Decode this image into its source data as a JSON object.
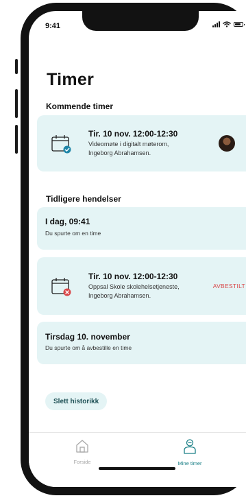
{
  "status_bar": {
    "time": "9:41"
  },
  "page": {
    "title": "Timer"
  },
  "upcoming": {
    "heading": "Kommende timer",
    "appointment": {
      "title": "Tir. 10 nov. 12:00-12:30",
      "line1": "Videomøte i digitalt møterom,",
      "line2": "Ingeborg Abrahamsen.",
      "icon": "calendar-check-icon"
    }
  },
  "history": {
    "heading": "Tidligere hendelser",
    "event1": {
      "title": "I dag, 09:41",
      "subtitle": "Du spurte om en time"
    },
    "cancelled": {
      "title": "Tir. 10 nov. 12:00-12:30",
      "line1": "Oppsal Skole skolehelsetjeneste,",
      "line2": "Ingeborg Abrahamsen.",
      "status": "AVBESTILT",
      "icon": "calendar-cancel-icon"
    },
    "event2": {
      "title": "Tirsdag 10. november",
      "subtitle": "Du spurte om å avbestille en time"
    }
  },
  "actions": {
    "clear_history": "Slett historikk"
  },
  "tabbar": {
    "tabs": [
      {
        "label": "Forside",
        "icon": "home-icon",
        "active": false
      },
      {
        "label": "Mine timer",
        "icon": "person-icon",
        "active": true
      }
    ]
  },
  "colors": {
    "card_bg": "#e4f4f5",
    "accent": "#1a7f86",
    "cancel": "#d9484a",
    "check_badge": "#1f86a8"
  }
}
